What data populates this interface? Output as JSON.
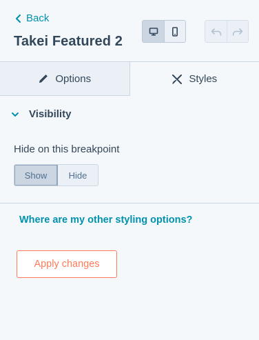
{
  "header": {
    "back_label": "Back",
    "title": "Takei Featured 2",
    "devices": [
      {
        "name": "desktop",
        "icon": "desktop-icon",
        "active": true
      },
      {
        "name": "mobile",
        "icon": "mobile-icon",
        "active": false
      }
    ],
    "history": [
      {
        "name": "undo",
        "icon": "undo-icon",
        "enabled": false
      },
      {
        "name": "redo",
        "icon": "redo-icon",
        "enabled": false
      }
    ]
  },
  "tabs": [
    {
      "label": "Options",
      "icon": "pencil-icon",
      "active": false
    },
    {
      "label": "Styles",
      "icon": "styles-icon",
      "active": true
    }
  ],
  "visibility": {
    "section_title": "Visibility",
    "expanded": true,
    "field_label": "Hide on this breakpoint",
    "options": [
      {
        "label": "Show",
        "selected": true
      },
      {
        "label": "Hide",
        "selected": false
      }
    ]
  },
  "help_link": "Where are my other styling options?",
  "apply_label": "Apply changes",
  "colors": {
    "link": "#0091ae",
    "accent": "#ff7a59",
    "text": "#33475b",
    "background": "#f5f8fa"
  }
}
